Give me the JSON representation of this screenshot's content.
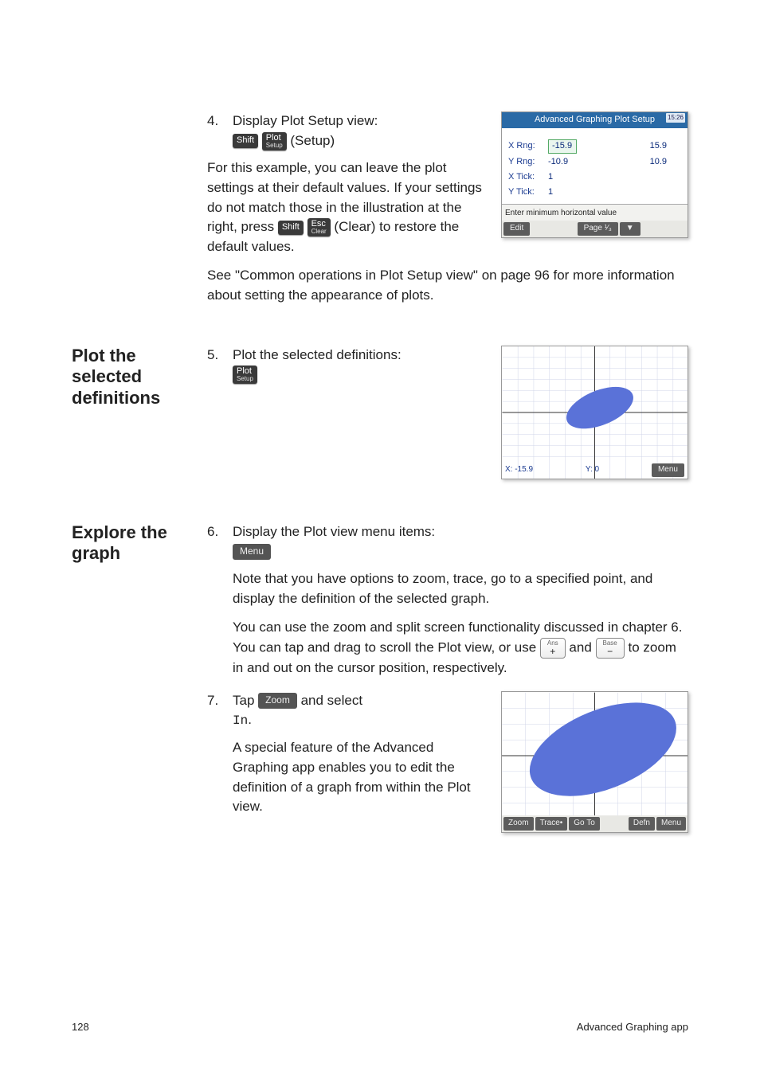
{
  "step4": {
    "num": "4.",
    "text": "Display Plot Setup view:",
    "key_shift": "Shift",
    "key_plot": "Plot",
    "key_plot_sub": "Setup",
    "paren": "(Setup)"
  },
  "para_settings_1": "For this example, you can leave the plot settings at their default values. If your settings do not match those in the illustration at the right, press ",
  "key_shift2": "Shift",
  "key_esc": "Esc",
  "key_esc_sub": "Clear",
  "para_settings_2": " (Clear) to restore the default values.",
  "para_see": "See \"Common operations in Plot Setup view\" on page 96 for more information about setting the appearance of plots.",
  "setup_shot": {
    "title": "Advanced Graphing Plot Setup",
    "time": "15:26",
    "xrng_label": "X Rng:",
    "xrng_a": "-15.9",
    "xrng_b": "15.9",
    "yrng_label": "Y Rng:",
    "yrng_a": "-10.9",
    "yrng_b": "10.9",
    "xtick_label": "X Tick:",
    "xtick": "1",
    "ytick_label": "Y Tick:",
    "ytick": "1",
    "help": "Enter minimum horizontal value",
    "menu_edit": "Edit",
    "menu_page": "Page ¹⁄₃",
    "menu_down": "▼"
  },
  "sec_plot": {
    "heading": "Plot the selected definitions",
    "num": "5.",
    "text": "Plot the selected definitions:",
    "key_plot": "Plot",
    "key_plot_sub": "Setup"
  },
  "plot_shot1": {
    "x_label": "X: -15.9",
    "y_label": "Y: 0",
    "menu": "Menu"
  },
  "sec_explore": {
    "heading": "Explore the graph",
    "num6": "6.",
    "text6": "Display the Plot view menu items:",
    "softkey_menu": "Menu",
    "para_note": "Note that you have options to zoom, trace, go to a specified point, and display the definition of the selected graph.",
    "para_zoom_a": "You can use the zoom and split screen functionality discussed in chapter 6. You can tap and drag to scroll the Plot view, or use ",
    "key_plus_main": "+",
    "key_plus_sub": "Ans",
    "para_zoom_b": " and ",
    "key_minus_main": "−",
    "key_minus_sub": "Base",
    "para_zoom_c": " to zoom in and out on the cursor position, respectively.",
    "num7": "7.",
    "text7a": "Tap ",
    "softkey_zoom": "Zoom",
    "text7b": " and select ",
    "in_code": "In",
    "text7c": ".",
    "para_special": "A special feature of the Advanced Graphing app enables you to edit the definition of a graph from within the Plot view."
  },
  "plot_shot2": {
    "menu_zoom": "Zoom",
    "menu_trace": "Trace•",
    "menu_goto": "Go To",
    "menu_defn": "Defn",
    "menu_menu": "Menu"
  },
  "footer": {
    "page": "128",
    "title": "Advanced Graphing app"
  }
}
